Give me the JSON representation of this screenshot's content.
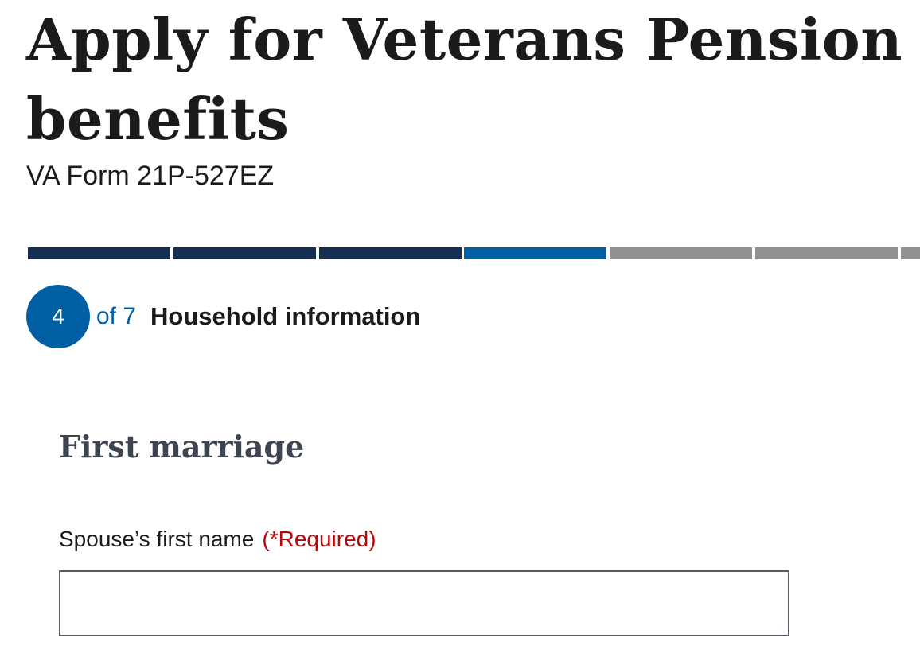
{
  "header": {
    "title": "Apply for Veterans Pension benefits",
    "subtitle": "VA Form 21P-527EZ"
  },
  "progress": {
    "total_steps": 7,
    "current_step": 4,
    "colors": {
      "complete": "#162e51",
      "current": "#005ea2",
      "todo": "#919191"
    }
  },
  "step_indicator": {
    "number": "4",
    "of_text": "of 7",
    "name": "Household information"
  },
  "section": {
    "heading": "First marriage"
  },
  "form": {
    "spouse_first_name": {
      "label": "Spouse’s first name",
      "required_text": "(*Required)",
      "value": "",
      "placeholder": ""
    }
  },
  "colors": {
    "primary": "#005ea2",
    "dark_navy": "#162e51",
    "required_red": "#b50909",
    "heading_gray": "#3d4551"
  }
}
